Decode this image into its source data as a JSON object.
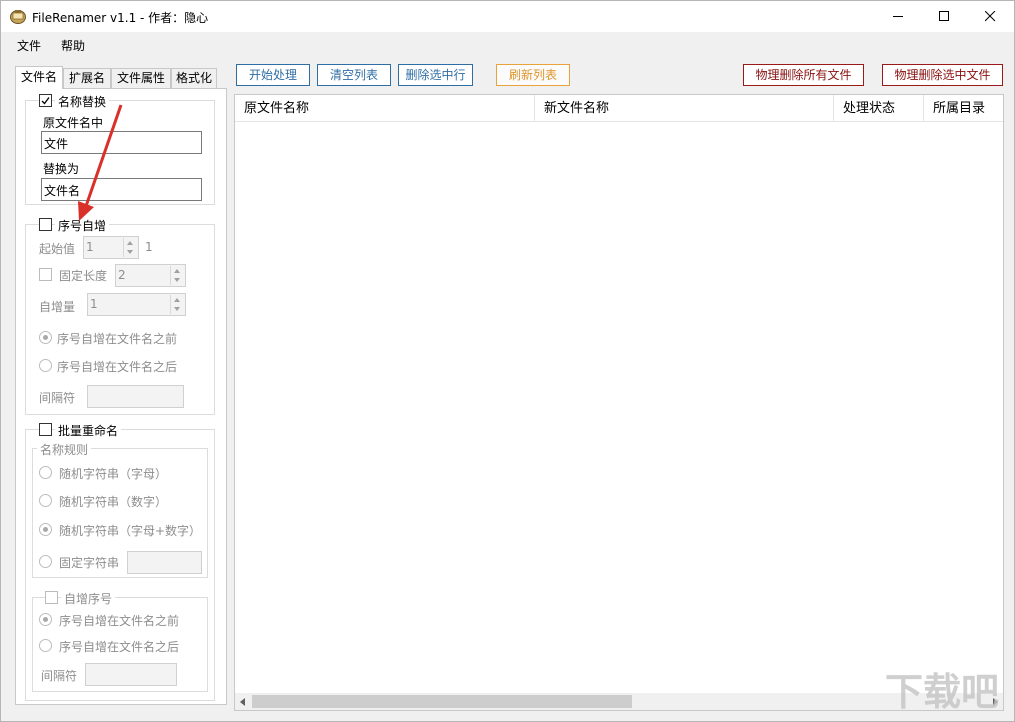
{
  "window": {
    "title": "FileRenamer v1.1 - 作者：隐心",
    "controls": [
      "minimize",
      "maximize",
      "close"
    ]
  },
  "menu": [
    "文件",
    "帮助"
  ],
  "tabs": [
    "文件名",
    "扩展名",
    "文件属性",
    "格式化"
  ],
  "active_tab": "文件名",
  "name_replace": {
    "label": "名称替换",
    "checked": true,
    "source_label": "原文件名中",
    "source_value": "文件",
    "target_label": "替换为",
    "target_value": "文件名"
  },
  "sequence": {
    "label": "序号自增",
    "checked": false,
    "start_label": "起始值",
    "start_value": "1",
    "start_preview": "1",
    "fixed_length_label": "固定长度",
    "fixed_length_value": "2",
    "increment_label": "自增量",
    "increment_value": "1",
    "before_label": "序号自增在文件名之前",
    "after_label": "序号自增在文件名之后",
    "separator_label": "间隔符",
    "separator_value": ""
  },
  "batch_rename": {
    "label": "批量重命名",
    "checked": false,
    "rule_group_label": "名称规则",
    "rules": [
      "随机字符串（字母）",
      "随机字符串（数字）",
      "随机字符串（字母+数字）",
      "固定字符串"
    ],
    "selected_rule": "随机字符串（字母+数字）",
    "fixed_value": "",
    "auto_seq_label": "自增序号",
    "seq_before_label": "序号自增在文件名之前",
    "seq_after_label": "序号自增在文件名之后",
    "seq_separator_label": "间隔符",
    "seq_separator_value": ""
  },
  "toolbar": {
    "start": "开始处理",
    "clear": "清空列表",
    "delete_selected_row": "删除选中行",
    "refresh": "刷新列表",
    "delete_all_files": "物理删除所有文件",
    "delete_selected_files": "物理删除选中文件"
  },
  "list": {
    "columns": [
      "原文件名称",
      "新文件名称",
      "处理状态",
      "所属目录"
    ],
    "rows": []
  },
  "watermark": "下载吧",
  "colors": {
    "accent_blue": "#2f6ea5",
    "refresh_orange": "#e0952a",
    "danger_red": "#8a1010",
    "annotation_arrow": "#d9302a"
  }
}
